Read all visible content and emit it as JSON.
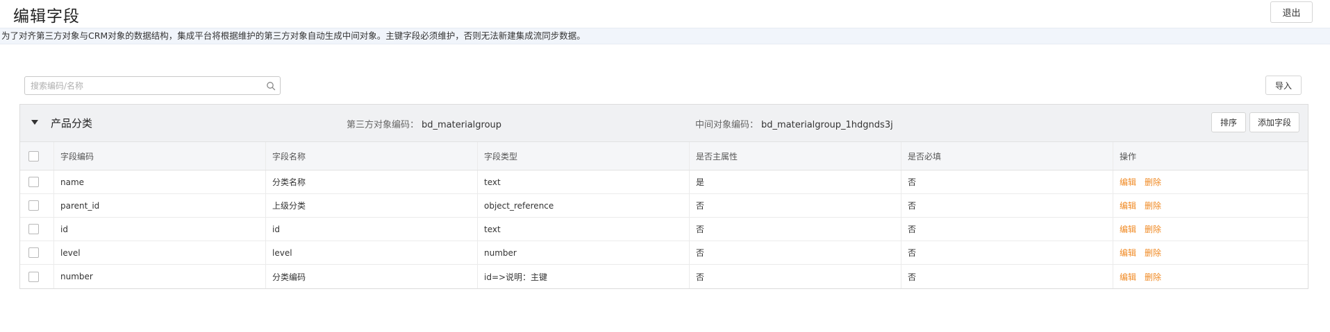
{
  "header": {
    "title": "编辑字段",
    "exit_label": "退出"
  },
  "notice": "为了对齐第三方对象与CRM对象的数据结构，集成平台将根据维护的第三方对象自动生成中间对象。主键字段必须维护，否则无法新建集成流同步数据。",
  "search": {
    "placeholder": "搜索编码/名称",
    "value": ""
  },
  "toolbar": {
    "import_label": "导入"
  },
  "group": {
    "name": "产品分类",
    "third_code_label": "第三方对象编码：",
    "third_code_value": "bd_materialgroup",
    "mid_code_label": "中间对象编码：",
    "mid_code_value": "bd_materialgroup_1hdgnds3j",
    "sort_label": "排序",
    "add_field_label": "添加字段"
  },
  "table": {
    "columns": [
      "字段编码",
      "字段名称",
      "字段类型",
      "是否主属性",
      "是否必填",
      "操作"
    ],
    "rows": [
      {
        "code": "name",
        "name": "分类名称",
        "type": "text",
        "is_main": "是",
        "required": "否"
      },
      {
        "code": "parent_id",
        "name": "上级分类",
        "type": "object_reference",
        "is_main": "否",
        "required": "否"
      },
      {
        "code": "id",
        "name": "id",
        "type": "text",
        "is_main": "否",
        "required": "否"
      },
      {
        "code": "level",
        "name": "level",
        "type": "number",
        "is_main": "否",
        "required": "否"
      },
      {
        "code": "number",
        "name": "分类编码",
        "type": "id=>说明：主键",
        "is_main": "否",
        "required": "否"
      }
    ],
    "actions": {
      "edit": "编辑",
      "delete": "删除"
    }
  },
  "colors": {
    "action_link": "#f08a24",
    "notice_bg": "#f1f5fb",
    "group_header_bg": "#f0f1f3"
  }
}
